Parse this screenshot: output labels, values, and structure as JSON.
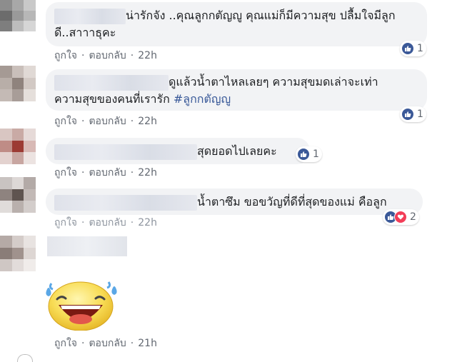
{
  "comments": [
    {
      "text": "น่ารักจัง ..คุณลูกกตัญญู คุณแม่ก็มีความสุข ปลื้มใจมีลูกดี..สาาาธุคะ",
      "line1": "น่ารักจัง ..คุณลูกกตัญญู คุณแม่ก็มีความสุข ปลื้มใจมีลูก",
      "line2": "ดี..สาาาธุคะ",
      "like_label": "ถูกใจ",
      "reply_label": "ตอบกลับ",
      "time": "22h",
      "reaction_count": "1"
    },
    {
      "line1": "ดูแล้วน้ำตาไหลเลยๆ ความสุขมดเล่าจะเท่า",
      "line2": "ความสุขของคนที่เรารัก",
      "hashtag": "#ลูกกตัญญู",
      "like_label": "ถูกใจ",
      "reply_label": "ตอบกลับ",
      "time": "22h",
      "reaction_count": "1"
    },
    {
      "line1": "สุดยอดไปเลยคะ",
      "like_label": "ถูกใจ",
      "reply_label": "ตอบกลับ",
      "time": "22h",
      "reaction_count": "1"
    },
    {
      "line1": "น้ำตาซึม ขอขวัญที่ดีที่สุดของแม่ คือลูก",
      "like_label": "ถูกใจ",
      "reply_label": "ตอบกลับ",
      "time": "22h",
      "reaction_count": "2"
    },
    {
      "sticker": "laughing-emoji-sticker",
      "like_label": "ถูกใจ",
      "reply_label": "ตอบกลับ",
      "time": "21h"
    }
  ],
  "separator": "·",
  "colors": {
    "bubble": "#f2f3f5",
    "link": "#385898",
    "like": "#3b5998",
    "love": "#f33e58",
    "meta": "#616770"
  }
}
